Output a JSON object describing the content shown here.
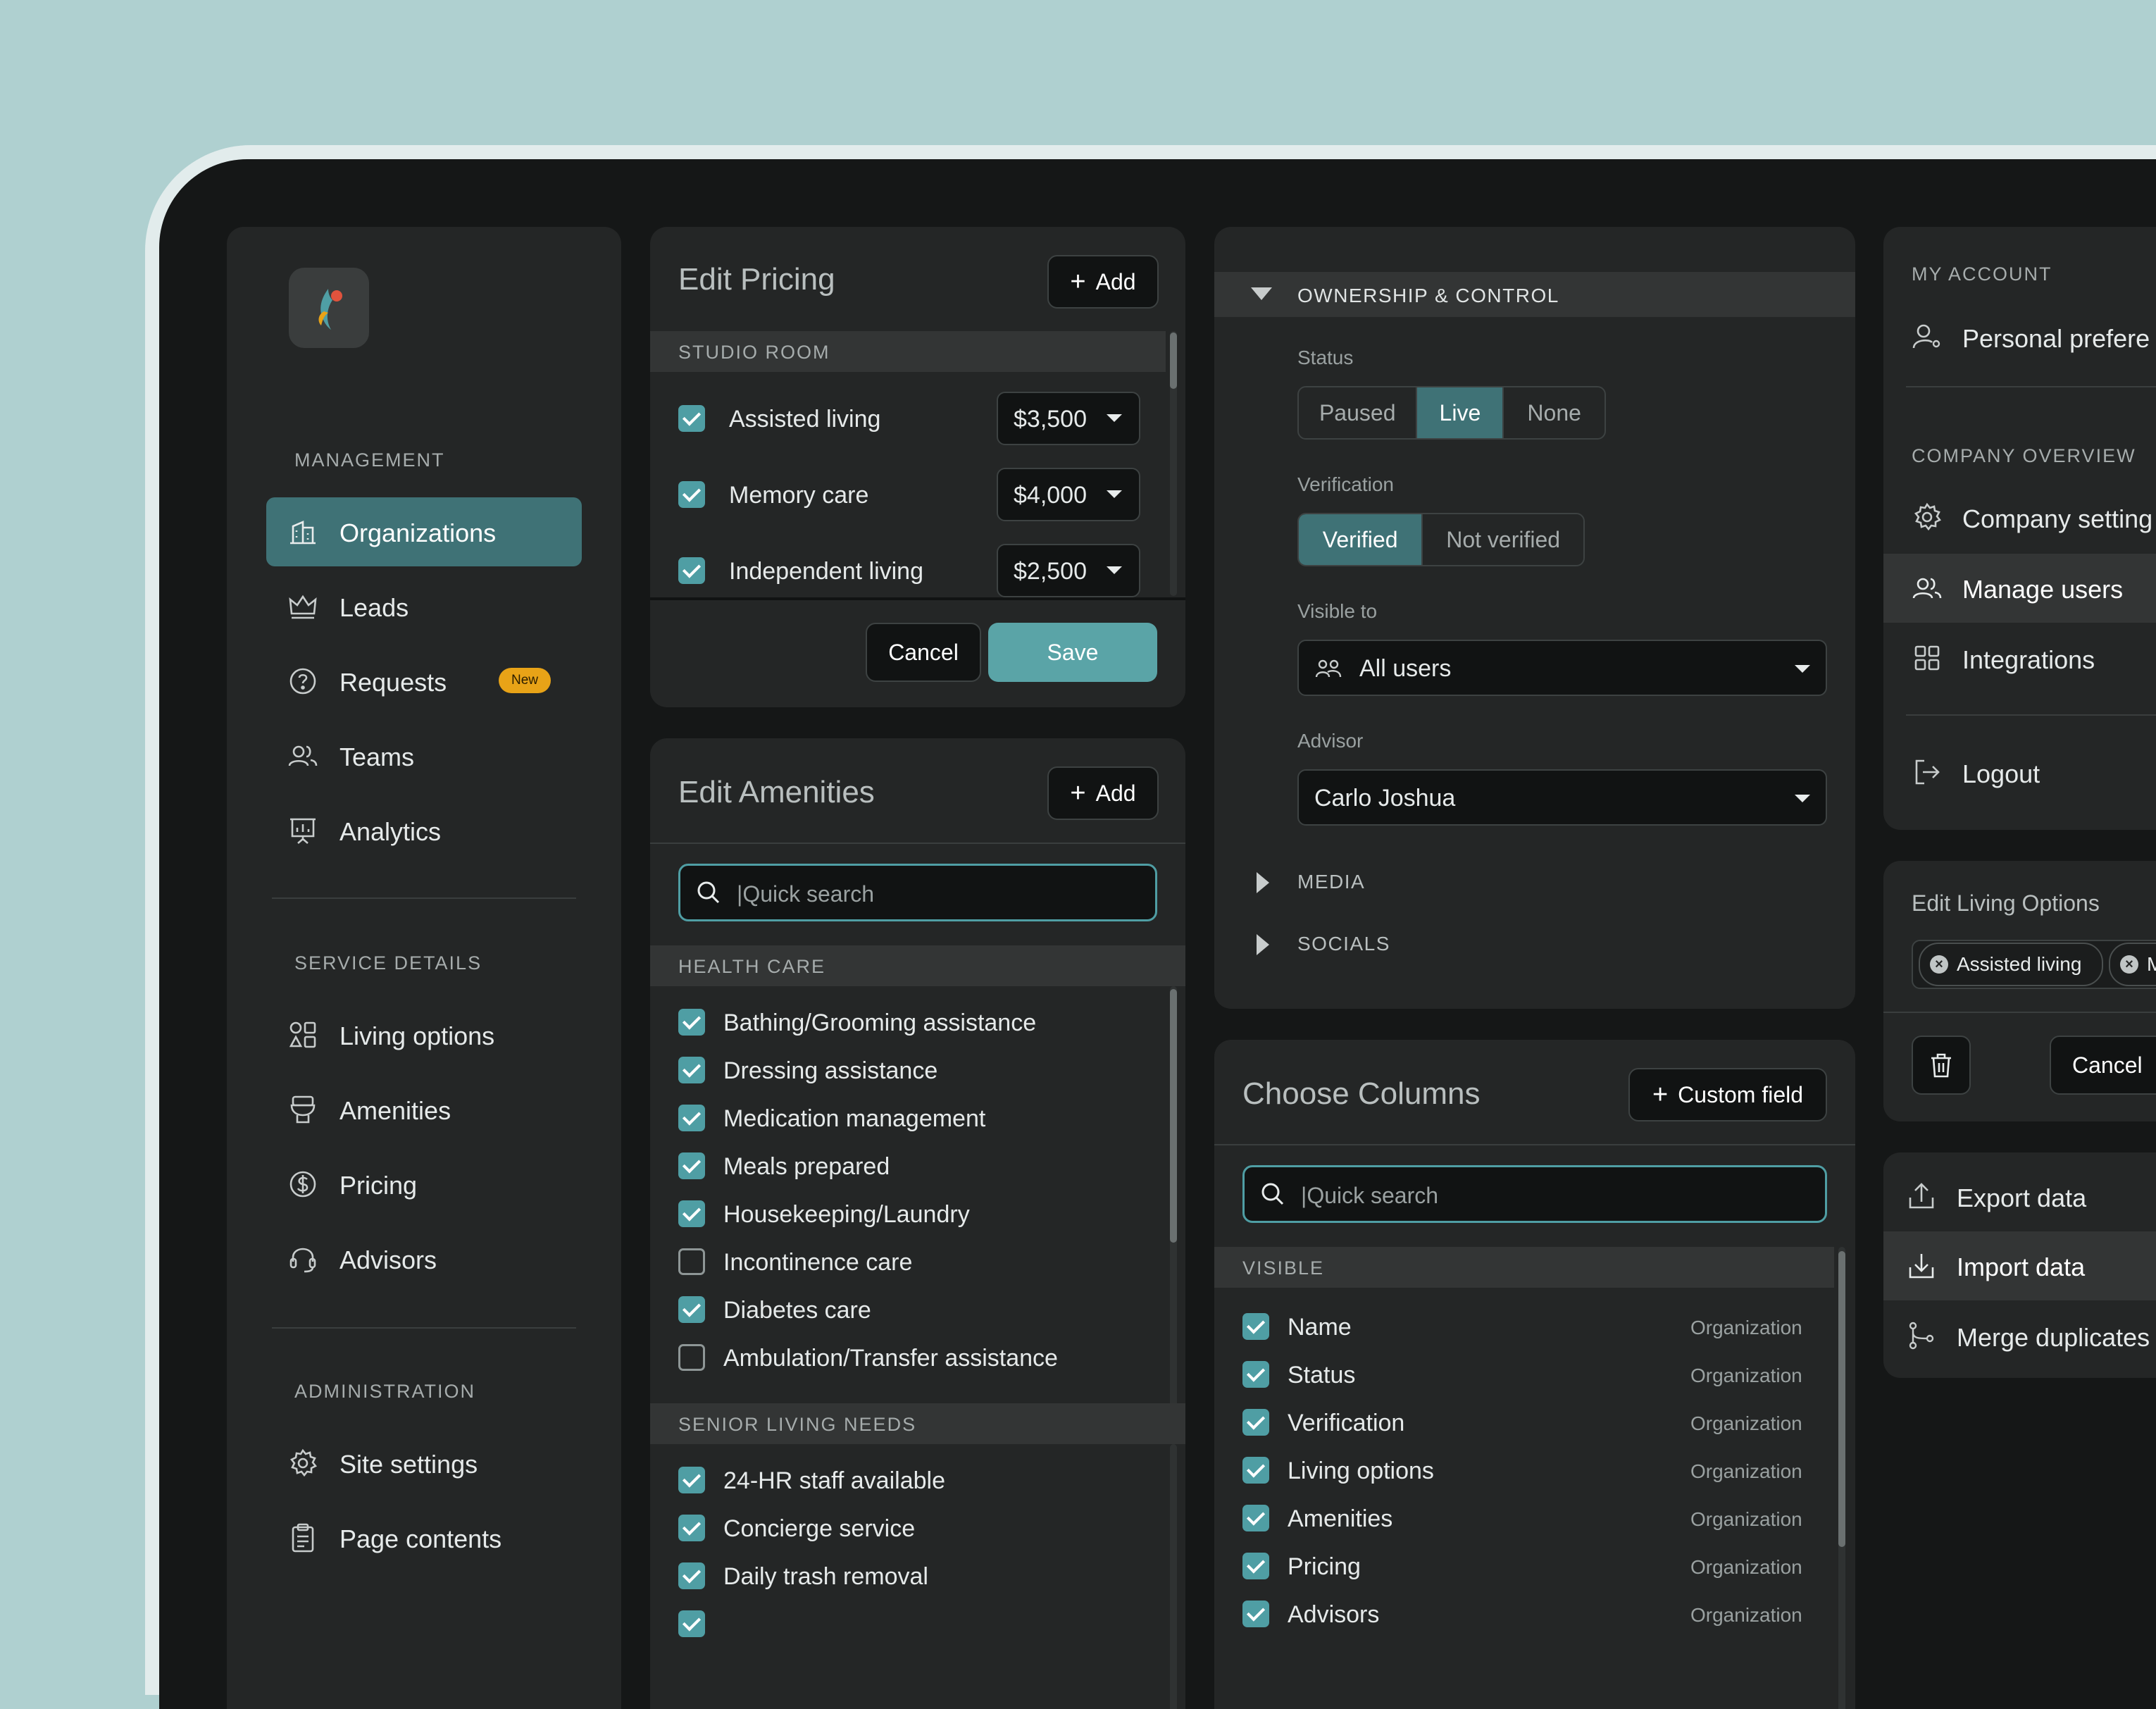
{
  "sidebar": {
    "sections": {
      "management": "MANAGEMENT",
      "service_details": "SERVICE DETAILS",
      "administration": "ADMINISTRATION"
    },
    "items": {
      "organizations": "Organizations",
      "leads": "Leads",
      "requests": "Requests",
      "requests_badge": "New",
      "teams": "Teams",
      "analytics": "Analytics",
      "living_options": "Living options",
      "amenities": "Amenities",
      "pricing": "Pricing",
      "advisors": "Advisors",
      "site_settings": "Site settings",
      "page_contents": "Page contents"
    }
  },
  "pricing": {
    "title": "Edit Pricing",
    "add_label": "Add",
    "group": "STUDIO ROOM",
    "rows": [
      {
        "label": "Assisted living",
        "price": "$3,500",
        "checked": true
      },
      {
        "label": "Memory care",
        "price": "$4,000",
        "checked": true
      },
      {
        "label": "Independent living",
        "price": "$2,500",
        "checked": true
      }
    ],
    "cancel_label": "Cancel",
    "save_label": "Save"
  },
  "amenities": {
    "title": "Edit Amenities",
    "add_label": "Add",
    "search_placeholder": "|Quick search",
    "groups": [
      {
        "name": "HEALTH CARE",
        "items": [
          {
            "label": "Bathing/Grooming assistance",
            "checked": true
          },
          {
            "label": "Dressing assistance",
            "checked": true
          },
          {
            "label": "Medication management",
            "checked": true
          },
          {
            "label": "Meals prepared",
            "checked": true
          },
          {
            "label": "Housekeeping/Laundry",
            "checked": true
          },
          {
            "label": "Incontinence care",
            "checked": false
          },
          {
            "label": "Diabetes care",
            "checked": true
          },
          {
            "label": "Ambulation/Transfer assistance",
            "checked": false
          }
        ]
      },
      {
        "name": "SENIOR LIVING NEEDS",
        "items": [
          {
            "label": "24-HR staff available",
            "checked": true
          },
          {
            "label": "Concierge service",
            "checked": true
          },
          {
            "label": "Daily trash removal",
            "checked": true
          }
        ]
      }
    ]
  },
  "ownership": {
    "section_title": "OWNERSHIP & CONTROL",
    "status_label": "Status",
    "status_options": [
      "Paused",
      "Live",
      "None"
    ],
    "status_selected": "Live",
    "verification_label": "Verification",
    "verification_options": [
      "Verified",
      "Not verified"
    ],
    "verification_selected": "Verified",
    "visible_to_label": "Visible to",
    "visible_to_value": "All users",
    "advisor_label": "Advisor",
    "advisor_value": "Carlo Joshua",
    "media_label": "MEDIA",
    "socials_label": "SOCIALS"
  },
  "columns": {
    "title": "Choose Columns",
    "custom_field_label": "Custom field",
    "search_placeholder": "|Quick search",
    "visible_header": "VISIBLE",
    "rows": [
      {
        "label": "Name",
        "source": "Organization",
        "checked": true
      },
      {
        "label": "Status",
        "source": "Organization",
        "checked": true
      },
      {
        "label": "Verification",
        "source": "Organization",
        "checked": true
      },
      {
        "label": "Living options",
        "source": "Organization",
        "checked": true
      },
      {
        "label": "Amenities",
        "source": "Organization",
        "checked": true
      },
      {
        "label": "Pricing",
        "source": "Organization",
        "checked": true
      },
      {
        "label": "Advisors",
        "source": "Organization",
        "checked": true
      }
    ]
  },
  "account_menu": {
    "my_account_header": "MY ACCOUNT",
    "personal_preferences": "Personal prefere",
    "company_overview_header": "COMPANY OVERVIEW",
    "company_settings": "Company setting",
    "manage_users": "Manage users",
    "integrations": "Integrations",
    "logout": "Logout"
  },
  "living_options": {
    "title": "Edit Living Options",
    "chips": [
      "Assisted living",
      "Me"
    ],
    "cancel_label": "Cancel"
  },
  "data_menu": {
    "export": "Export data",
    "import": "Import data",
    "merge": "Merge duplicates"
  },
  "colors": {
    "accent": "#4f9ea4",
    "accent_dark": "#3f7276",
    "panel": "#242626",
    "background": "#afd0d0",
    "badge": "#e8a317"
  }
}
